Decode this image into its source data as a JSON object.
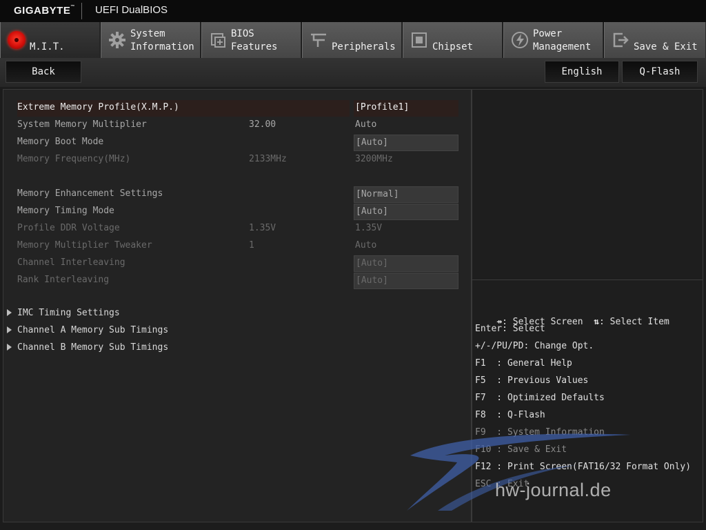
{
  "title": {
    "brand": "GIGABYTE",
    "brand_tm": "™",
    "product": "UEFI DualBIOS"
  },
  "tabs": [
    {
      "line1": "",
      "line2": "M.I.T.",
      "icon": "mit-icon",
      "active": true
    },
    {
      "line1": "System",
      "line2": "Information",
      "icon": "gear-icon"
    },
    {
      "line1": "BIOS",
      "line2": "Features",
      "icon": "bios-chip-icon"
    },
    {
      "line1": "",
      "line2": "Peripherals",
      "icon": "peripherals-icon"
    },
    {
      "line1": "",
      "line2": "Chipset",
      "icon": "chipset-icon"
    },
    {
      "line1": "Power",
      "line2": "Management",
      "icon": "power-icon"
    },
    {
      "line1": "",
      "line2": "Save & Exit",
      "icon": "exit-icon"
    }
  ],
  "toolbar": {
    "back": "Back",
    "language": "English",
    "qflash": "Q-Flash"
  },
  "settings": [
    {
      "label": "Extreme Memory Profile(X.M.P.)",
      "current": "",
      "value": "[Profile1]",
      "state": "selected"
    },
    {
      "label": "System Memory Multiplier",
      "current": "32.00",
      "value": "Auto",
      "state": "info"
    },
    {
      "label": "Memory Boot Mode",
      "current": "",
      "value": "[Auto]",
      "state": "option"
    },
    {
      "label": "Memory Frequency(MHz)",
      "current": "2133MHz",
      "value": "3200MHz",
      "state": "disabled"
    },
    {
      "label": "Memory Enhancement Settings",
      "current": "",
      "value": "[Normal]",
      "state": "option"
    },
    {
      "label": "Memory Timing Mode",
      "current": "",
      "value": "[Auto]",
      "state": "option"
    },
    {
      "label": "Profile DDR Voltage",
      "current": "1.35V",
      "value": "1.35V",
      "state": "locked"
    },
    {
      "label": "Memory Multiplier Tweaker",
      "current": "1",
      "value": "Auto",
      "state": "locked"
    },
    {
      "label": "Channel Interleaving",
      "current": "",
      "value": "[Auto]",
      "state": "locked-option"
    },
    {
      "label": "Rank Interleaving",
      "current": "",
      "value": "[Auto]",
      "state": "locked-option"
    }
  ],
  "submenus": [
    "IMC Timing Settings",
    "Channel A Memory Sub Timings",
    "Channel B Memory Sub Timings"
  ],
  "help": [
    {
      "icon": "⇸",
      "text": ": Select Screen  ",
      "icon2": "⇅",
      "text2": ": Select Item"
    },
    {
      "text": "Enter: Select"
    },
    {
      "text": "+/-/PU/PD: Change Opt."
    },
    {
      "text": "F1  : General Help"
    },
    {
      "text": "F5  : Previous Values"
    },
    {
      "text": "F7  : Optimized Defaults"
    },
    {
      "text": "F8  : Q-Flash"
    },
    {
      "text": "F9  : System Information",
      "dim": true
    },
    {
      "text": "F10 : Save & Exit",
      "dim": true
    },
    {
      "text": "F12 : Print Screen(FAT16/32 Format Only)"
    },
    {
      "text": "ESC : Exit",
      "dim": true
    }
  ],
  "watermark": {
    "text": "hw-journal.de",
    "color": "#3f5fa8"
  },
  "colors": {
    "selected_row": "#2c1f1c",
    "tab_active": "#2f2f2f",
    "tab": "#525252",
    "mit_red": "#d40f0a"
  }
}
